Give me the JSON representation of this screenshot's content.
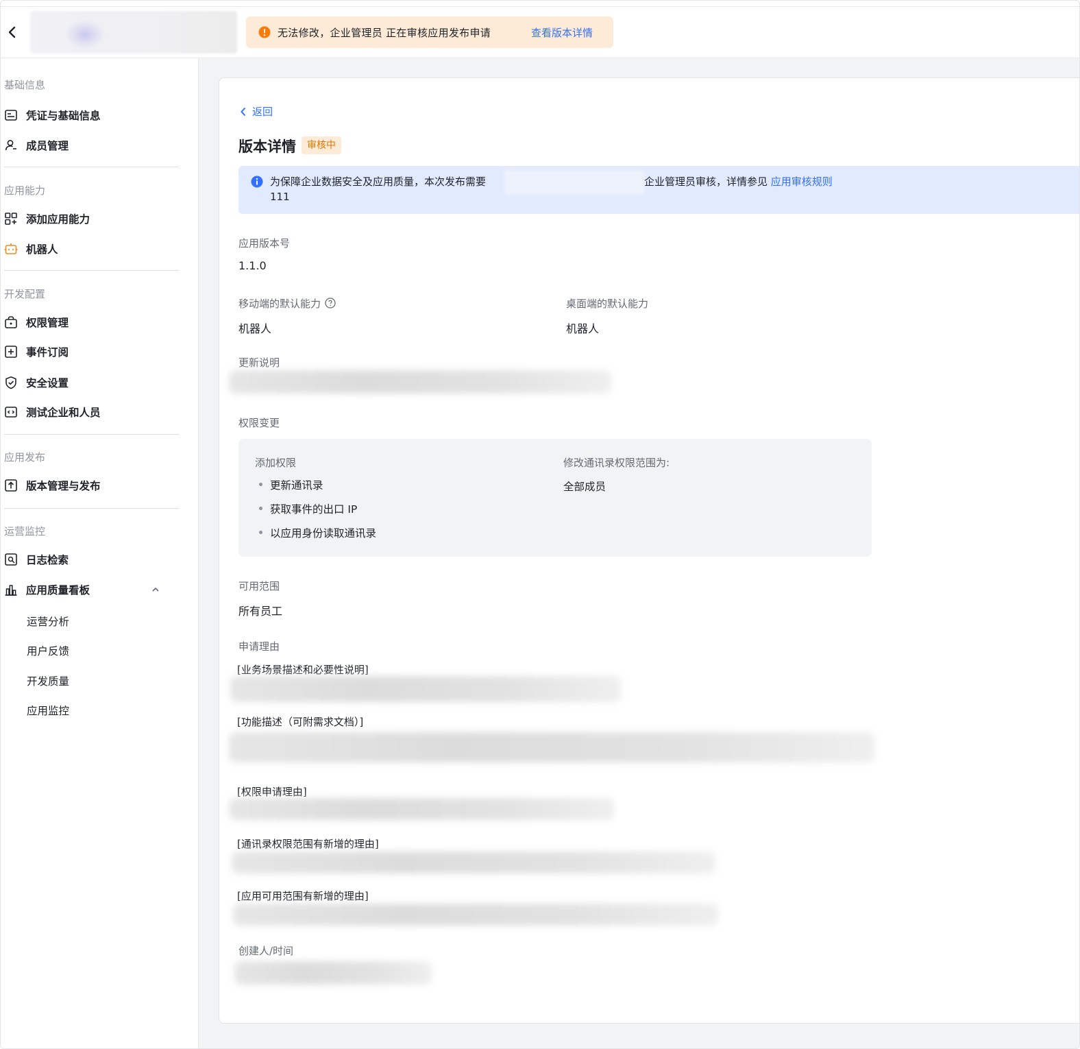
{
  "topbar": {
    "warning_text": "无法修改，企业管理员 正在审核应用发布申请",
    "warning_link": "查看版本详情",
    "colors": {
      "warning_bg": "#fdebd7",
      "warning_icon": "#f77b08",
      "link": "#3370ff"
    }
  },
  "sidebar": {
    "groups": [
      {
        "title": "基础信息",
        "items": [
          {
            "label": "凭证与基础信息",
            "icon": "id-card-icon"
          },
          {
            "label": "成员管理",
            "icon": "user-icon"
          }
        ]
      },
      {
        "title": "应用能力",
        "items": [
          {
            "label": "添加应用能力",
            "icon": "grid-add-icon"
          },
          {
            "label": "机器人",
            "icon": "robot-icon"
          }
        ]
      },
      {
        "title": "开发配置",
        "items": [
          {
            "label": "权限管理",
            "icon": "lock-box-icon"
          },
          {
            "label": "事件订阅",
            "icon": "event-icon"
          },
          {
            "label": "安全设置",
            "icon": "shield-icon"
          },
          {
            "label": "测试企业和人员",
            "icon": "code-box-icon"
          }
        ]
      },
      {
        "title": "应用发布",
        "items": [
          {
            "label": "版本管理与发布",
            "icon": "upload-icon"
          }
        ]
      },
      {
        "title": "运营监控",
        "items": [
          {
            "label": "日志检索",
            "icon": "log-search-icon"
          },
          {
            "label": "应用质量看板",
            "icon": "bar-chart-icon"
          }
        ]
      }
    ],
    "sub_items": [
      "运营分析",
      "用户反馈",
      "开发质量",
      "应用监控"
    ]
  },
  "main": {
    "back_label": "返回",
    "title": "版本详情",
    "status_tag": "审核中",
    "info": {
      "text_before": "为保障企业数据安全及应用质量，本次发布需要",
      "text_after": "企业管理员审核，详情参见 ",
      "link": "应用审核规则",
      "line2": "111"
    },
    "version_label": "应用版本号",
    "version_value": "1.1.0",
    "mobile_label": "移动端的默认能力",
    "mobile_value": "机器人",
    "desktop_label": "桌面端的默认能力",
    "desktop_value": "机器人",
    "update_label": "更新说明",
    "perm_change_label": "权限变更",
    "perm_add_title": "添加权限",
    "perm_add_items": [
      "更新通讯录",
      "获取事件的出口 IP",
      "以应用身份读取通讯录"
    ],
    "perm_scope_title": "修改通讯录权限范围为:",
    "perm_scope_value": "全部成员",
    "range_label": "可用范围",
    "range_value": "所有员工",
    "reason_label": "申请理由",
    "reasons": [
      "[业务场景描述和必要性说明]",
      "[功能描述（可附需求文档）]",
      "[权限申请理由]",
      "[通讯录权限范围有新增的理由]",
      "[应用可用范围有新增的理由]"
    ],
    "creator_label": "创建人/时间",
    "colors": {
      "tag_bg": "#fdebd7",
      "tag_text": "#de7802",
      "info_bg": "#e1eaff"
    }
  }
}
